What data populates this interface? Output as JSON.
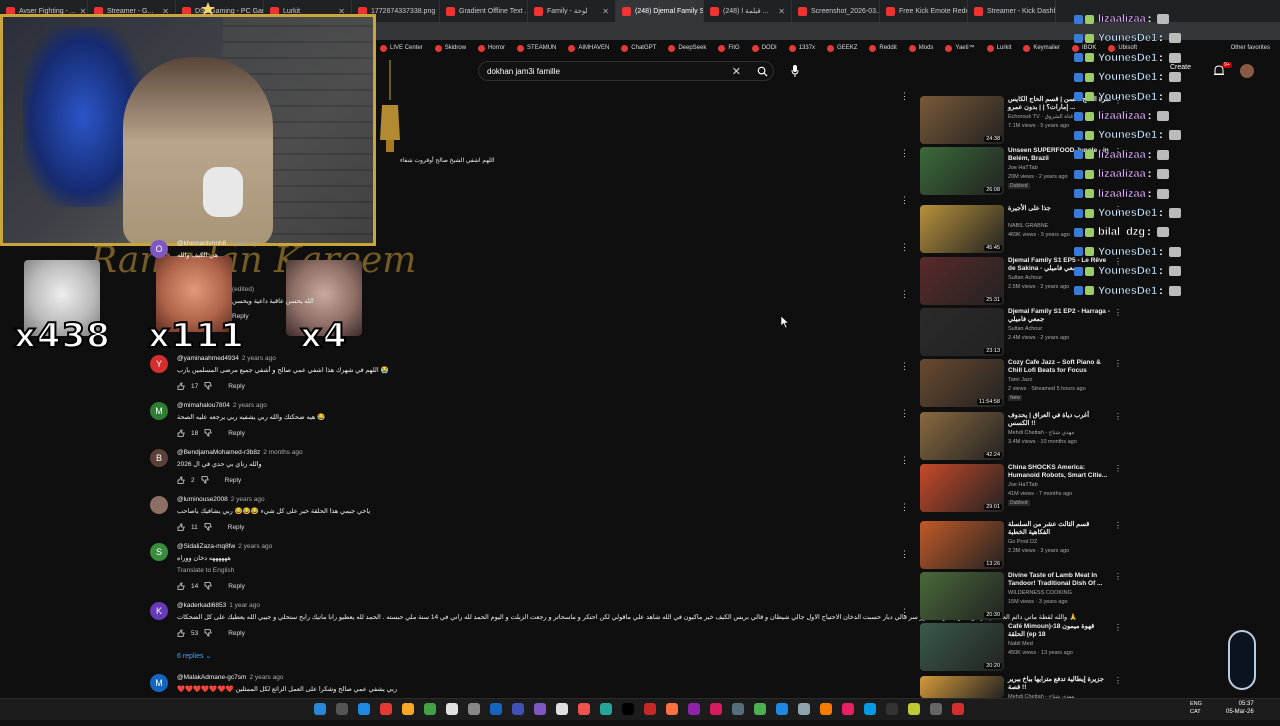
{
  "browser": {
    "tabs": [
      {
        "label": "Avser Fighting - ...",
        "active": false
      },
      {
        "label": "Streamer - G...",
        "active": false
      },
      {
        "label": "DSOGaming - PC Gam...",
        "active": false
      },
      {
        "label": "Lurkit",
        "active": false
      },
      {
        "label": "1772674337338.png",
        "active": false
      },
      {
        "label": "Gradient Offline Text ...",
        "active": false
      },
      {
        "label": "Family - لوحة",
        "active": false
      },
      {
        "label": "(248) Djemal Family S...",
        "active": true
      },
      {
        "label": "(248) قيلمة ا ...",
        "active": false
      },
      {
        "label": "Screenshot_2026-03...",
        "active": false
      },
      {
        "label": "Free Kick Emote Redem...",
        "active": false
      },
      {
        "label": "Streamer - Kick Dashbo...",
        "active": false
      }
    ],
    "bookmarks": [
      "LIVE Center",
      "Skidrow",
      "Horror",
      "STEAMUN",
      "AIMHAVEN",
      "ChatGPT",
      "DeepSeek",
      "FitG",
      "DODI",
      "1337x",
      "GEEKZ",
      "Reddit",
      "Mods",
      "Yaeti™",
      "Lurkit",
      "Keymailer",
      "IBOK",
      "Ubisoft"
    ],
    "other_favorites": "Other favorites",
    "url_fragment": "www.youtube.com/watch?v=..."
  },
  "youtube": {
    "search_query": "dokhan jam3i famille",
    "create_label": "Create",
    "notif_count": "9+"
  },
  "overlay": {
    "watermark": "Ramadan Kareem",
    "emotes": [
      {
        "count": "x438",
        "color": "#c8c8c8"
      },
      {
        "count": "x111",
        "color": "#c0765a"
      },
      {
        "count": "x4",
        "color": "#9a7e76"
      }
    ]
  },
  "top_comment_text": "اللهم اشفي الشيخ صالح أوقروت شفاء",
  "partial_comment": {
    "user": "@khemantvnnh8",
    "time": "1 year ago",
    "text": "هي الكيف والله",
    "edited": "(edited)",
    "text2": "الله يحسن عاقبة داعية ويحسن",
    "reply": "Reply"
  },
  "comments": [
    {
      "initial": "Y",
      "color": "#d32f2f",
      "user": "@yaminaahmed4934",
      "time": "2 years ago",
      "text": "اللهم في شهرك هذا اشفي عمي صالح و أشفي جميع مرضى المسلمين يارب 😭",
      "likes": "17",
      "reply": "Reply",
      "translate": ""
    },
    {
      "initial": "M",
      "color": "#2e7d32",
      "user": "@mimahalou7804",
      "time": "2 years ago",
      "text": "هيه ضحكتك والله ربي يشفيه ربي يرجعه عليه الصحة 😂",
      "likes": "18",
      "reply": "Reply",
      "translate": ""
    },
    {
      "initial": "B",
      "color": "#5d4037",
      "user": "@BendjamaMohamed-r3b8z",
      "time": "2 months ago",
      "text": "والله رناي بي حدي في ال 2026",
      "likes": "2",
      "reply": "Reply",
      "translate": ""
    },
    {
      "initial": "",
      "color": "#8d6e63",
      "user": "@luminouse2008",
      "time": "2 years ago",
      "text": "ياخي جيمي هذا الحلقة خير على كل شيء 😂😂😂 ربي يشافيك ياصاحب",
      "likes": "11",
      "reply": "Reply",
      "translate": ""
    },
    {
      "initial": "S",
      "color": "#388e3c",
      "user": "@SidaliZaza-mq8fw",
      "time": "2 years ago",
      "text": "ههههههه دخان ووراه",
      "likes": "14",
      "reply": "Reply",
      "translate": "Translate to English"
    },
    {
      "initial": "K",
      "color": "#673ab7",
      "user": "@kaderkadi6853",
      "time": "1 year ago",
      "text": "والله لقطة ماتي دائم الجديدي بريس الكوليت و الله عور سر قالي دبار حسبت الدخان الاحتياج الاول جالي شيطان و قالي بريس الكيف خير ماكيون في الله شاهد علي ماقولي لكن احتكر و ماسحاتر و رجعت الزبلت و اليوم الحمد لله راني في 14 سنة ملي حبسته . الحمد لله يعطيو رانا ماتيك رابح ستحلي و جيبي الله يعطيك على كل الضحكات 🙏",
      "likes": "53",
      "reply": "Reply",
      "translate": ""
    },
    {
      "initial": "M",
      "color": "#1565c0",
      "user": "@MalakAdmane-gc7sm",
      "time": "2 years ago",
      "text": "❤️❤️❤️❤️❤️❤️❤️ ربي يشفي عمي صالح وشكرا على العمل الرائع لكل الممثلين",
      "likes": "",
      "reply": "",
      "translate": ""
    }
  ],
  "replies_label": "6 replies",
  "sidebar_videos": [
    {
      "title": "ضرة الحاج لحسن | قسم الحاج الكايس إمارات؟ | | بدون عمرو ...",
      "channel": "Echorouk TV · قناة الشروق",
      "meta": "7.1M views · 5 years ago",
      "duration": "24:38",
      "badge": "",
      "thumb": "#7a5a38"
    },
    {
      "title": "Unseen SUPERFOOD Jungle - in Belém, Brazil",
      "channel": "Joe HaTTab",
      "meta": "20M views · 2 years ago",
      "duration": "26:08",
      "badge": "Dubbed",
      "thumb": "#3b6a3a"
    },
    {
      "title": "جذا على الأجيرة",
      "channel": "NABIL GRABNE",
      "meta": "469K views · 5 years ago",
      "duration": "45:45",
      "badge": "",
      "thumb": "#b8923c"
    },
    {
      "title": "Djemal Family S1 EP5 - Le Rêve de Sakina - جمعي فاميلي",
      "channel": "Sultan Achour",
      "meta": "2.5M views · 2 years ago",
      "duration": "25:31",
      "badge": "",
      "thumb": "#5a2a2a"
    },
    {
      "title": "Djemal Family S1 EP2 - Harraga - جمعي فاميلي",
      "channel": "Sultan Achour",
      "meta": "2.4M views · 2 years ago",
      "duration": "23:13",
      "badge": "",
      "thumb": "#2a2a2a"
    },
    {
      "title": "Cozy Cafe Jazz – Soft Piano & Chill Lofi Beats for Focus",
      "channel": "Tami Jazz",
      "meta": "2 views · Streamed 5 hours ago",
      "duration": "11:54:58",
      "badge": "New",
      "thumb": "#6a4a30"
    },
    {
      "title": "أغرب دياة في العراق | يحدوف الكسس !!",
      "channel": "Mehdi Chettah - مهدي شتاح",
      "meta": "3.4M views · 10 months ago",
      "duration": "42:24",
      "badge": "",
      "thumb": "#8a6a40"
    },
    {
      "title": "China SHOCKS America: Humanoid Robots, Smart Citie...",
      "channel": "Joe HaTTab",
      "meta": "41M views · 7 months ago",
      "duration": "29:01",
      "badge": "Dubbed",
      "thumb": "#c84a2a"
    },
    {
      "title": "قسم الثالث عشر من السلسلة الفكاهية الخطبة",
      "channel": "Go Prod DZ",
      "meta": "2.3M views · 3 years ago",
      "duration": "13:26",
      "badge": "",
      "thumb": "#c25a28"
    },
    {
      "title": "Divine Taste of Lamb Meat In Tandoor! Traditional Dish Of ...",
      "channel": "WILDERNESS COOKING",
      "meta": "15M views · 3 years ago",
      "duration": "20:30",
      "badge": "",
      "thumb": "#4a6a3a"
    },
    {
      "title": "Café Mimoun)-18 قهوة ميمون الحلقة (ep 18",
      "channel": "Nabil Med",
      "meta": "450K views · 13 years ago",
      "duration": "20:20",
      "badge": "",
      "thumb": "#3a5a4a"
    },
    {
      "title": "جزيرة إيطالية تدفع مترايها بباخ ببرير قصة !!",
      "channel": "Mehdi Chettah - مهدي شتاح",
      "meta": "",
      "duration": "",
      "badge": "",
      "thumb": "#d49a3a"
    }
  ],
  "chat": [
    {
      "user": "lizaalizaa",
      "color": "#e0b0ff"
    },
    {
      "user": "YounesDe1",
      "color": "#c8e6ff"
    },
    {
      "user": "YounesDe1",
      "color": "#c8e6ff"
    },
    {
      "user": "YounesDe1",
      "color": "#c8e6ff"
    },
    {
      "user": "YounesDe1",
      "color": "#c8e6ff"
    },
    {
      "user": "lizaalizaa",
      "color": "#e0b0ff"
    },
    {
      "user": "YounesDe1",
      "color": "#c8e6ff"
    },
    {
      "user": "lizaalizaa",
      "color": "#e0b0ff"
    },
    {
      "user": "lizaalizaa",
      "color": "#e0b0ff"
    },
    {
      "user": "lizaalizaa",
      "color": "#e0b0ff"
    },
    {
      "user": "YounesDe1",
      "color": "#c8e6ff"
    },
    {
      "user": "bilal_dzg",
      "color": "#ffffff"
    },
    {
      "user": "YounesDe1",
      "color": "#c8e6ff"
    },
    {
      "user": "YounesDe1",
      "color": "#c8e6ff"
    },
    {
      "user": "YounesDe1",
      "color": "#c8e6ff"
    }
  ],
  "tray": {
    "lang1": "ENG",
    "lang2": "CAT",
    "time": "05:37",
    "date": "05-Mar-26"
  },
  "colors": {
    "accent": "#c9a53a",
    "link": "#3ea6ff",
    "bg": "#0f0f0f"
  }
}
